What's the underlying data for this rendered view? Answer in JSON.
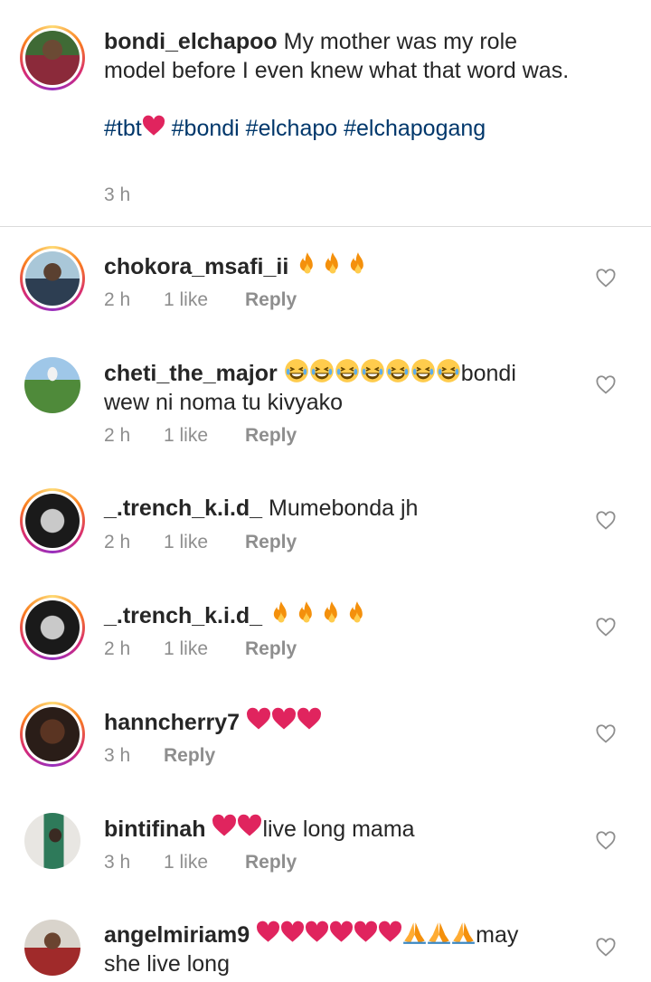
{
  "post": {
    "username": "bondi_elchapoo",
    "caption": "My mother was my role model before I even knew what that word was.",
    "hashtag_tbt": "#tbt",
    "hashtags_rest": "#bondi #elchapo #elchapogang",
    "time": "3 h"
  },
  "comments": [
    {
      "username": "chokora_msafi_ii",
      "text_after": "",
      "time": "2 h",
      "likes": "1 like",
      "reply": "Reply"
    },
    {
      "username": "cheti_the_major",
      "text_after": "bondi",
      "text_line2": "wew ni noma tu kivyako",
      "time": "2 h",
      "likes": "1 like",
      "reply": "Reply"
    },
    {
      "username": "_.trench_k.i.d_",
      "text": "Mumebonda jh",
      "time": "2 h",
      "likes": "1 like",
      "reply": "Reply"
    },
    {
      "username": "_.trench_k.i.d_",
      "time": "2 h",
      "likes": "1 like",
      "reply": "Reply"
    },
    {
      "username": "hanncherry7",
      "time": "3 h",
      "reply": "Reply"
    },
    {
      "username": "bintifinah",
      "text": "live long mama",
      "time": "3 h",
      "likes": "1 like",
      "reply": "Reply"
    },
    {
      "username": "angelmiriam9",
      "text": "may",
      "text_line2": "she live long"
    }
  ],
  "colors": {
    "link": "#00376b",
    "meta": "#8e8e8e",
    "fire": "#f4900c",
    "heart": "#e0245e"
  },
  "icons": [
    "fire-emoji",
    "laughing-emoji",
    "red-heart-emoji",
    "folded-hands-emoji",
    "heart-outline-icon"
  ]
}
